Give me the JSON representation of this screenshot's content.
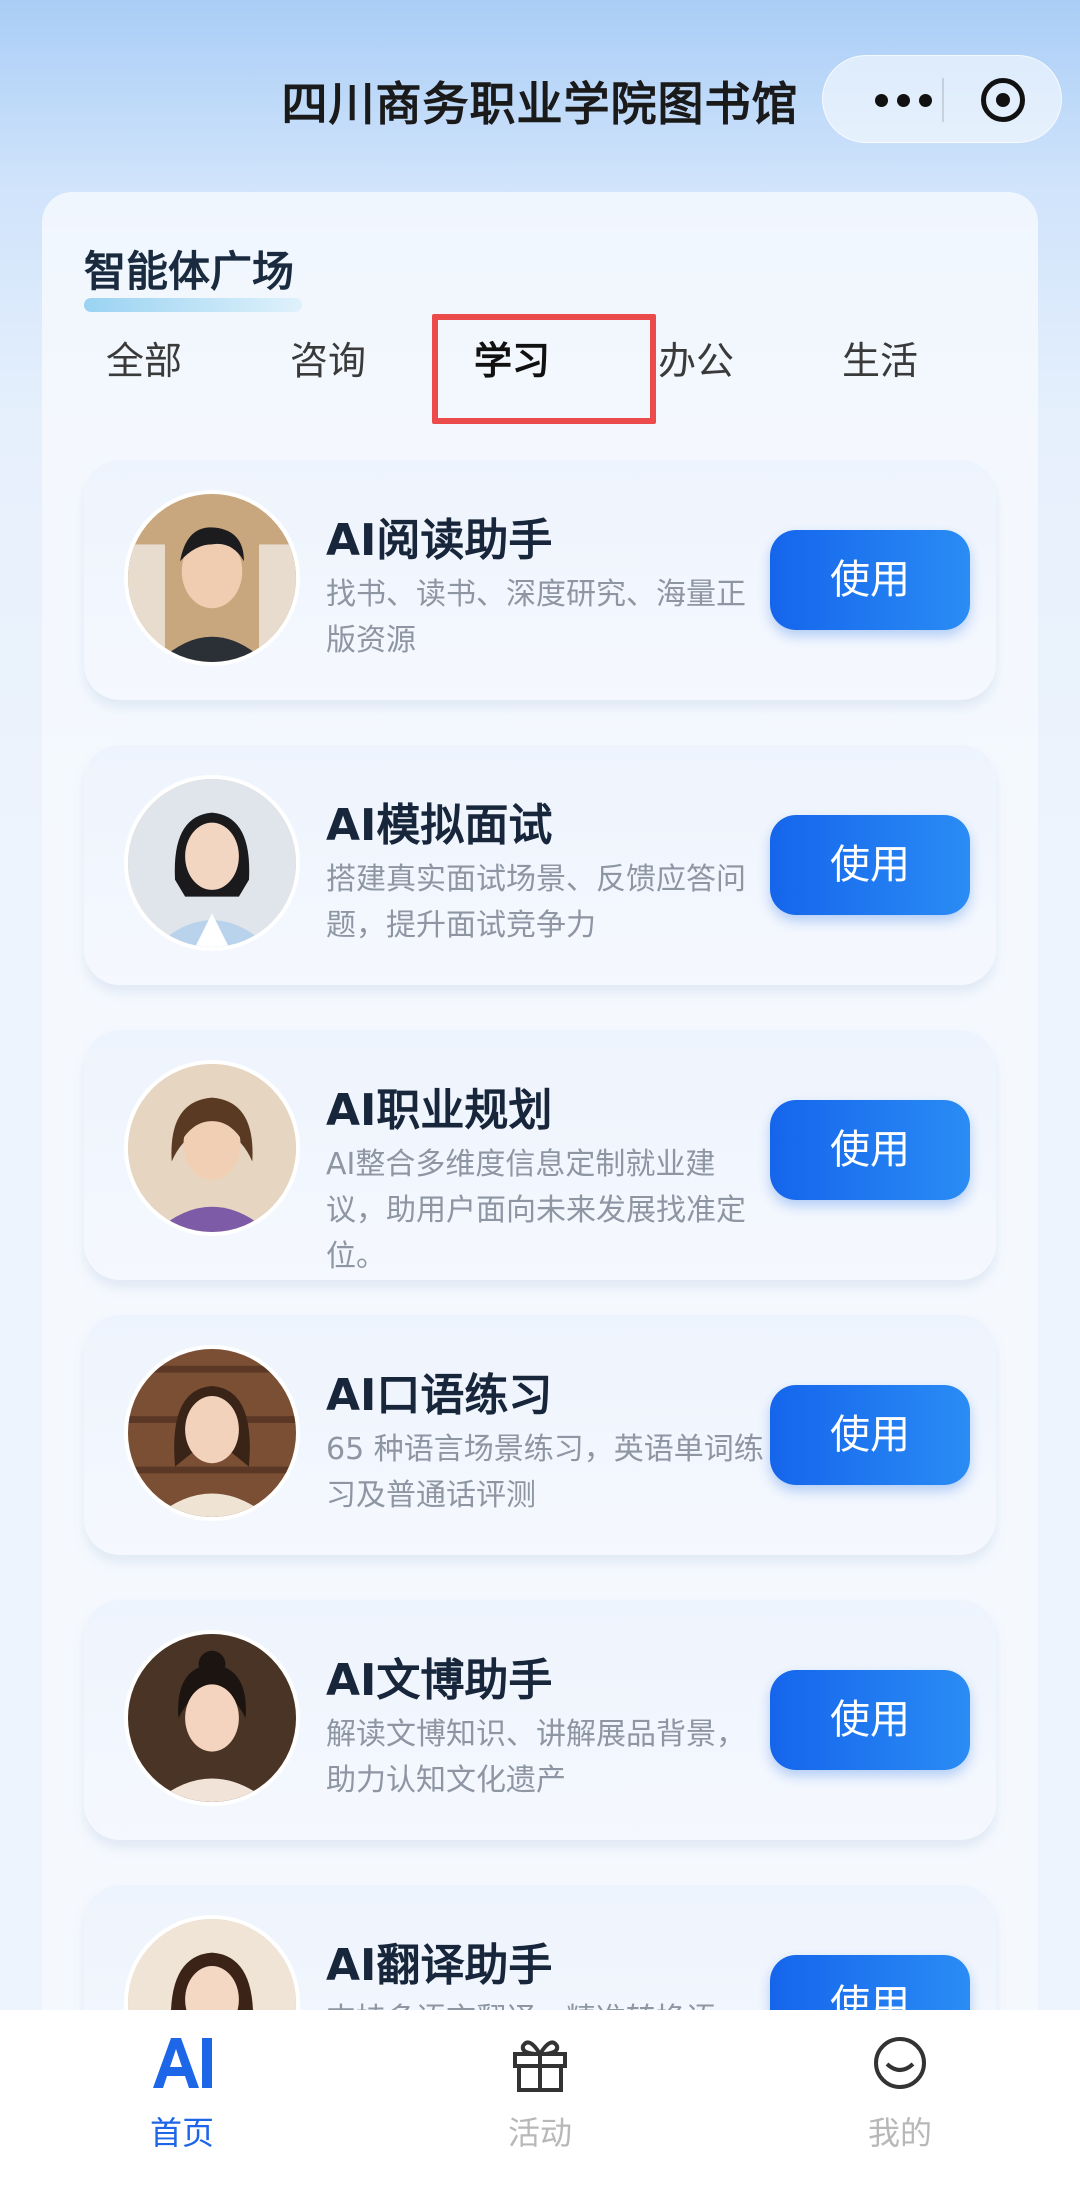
{
  "header": {
    "title": "四川商务职业学院图书馆",
    "more_icon": "more-dots-icon",
    "close_icon": "target-icon"
  },
  "section": {
    "title": "智能体广场"
  },
  "tabs": [
    {
      "label": "全部"
    },
    {
      "label": "咨询"
    },
    {
      "label": "学习",
      "active": true
    },
    {
      "label": "办公"
    },
    {
      "label": "生活"
    }
  ],
  "cards": [
    {
      "title": "AI阅读助手",
      "desc": "找书、读书、深度研究、海量正版资源",
      "button": "使用"
    },
    {
      "title": "AI模拟面试",
      "desc": "搭建真实面试场景、反馈应答问题，提升面试竞争力",
      "button": "使用"
    },
    {
      "title": "AI职业规划",
      "desc": "AI整合多维度信息定制就业建议，助用户面向未来发展找准定位。",
      "button": "使用"
    },
    {
      "title": "AI口语练习",
      "desc": "65 种语言场景练习，英语单词练习及普通话评测",
      "button": "使用"
    },
    {
      "title": "AI文博助手",
      "desc": "解读文博知识、讲解展品背景，助力认知文化遗产",
      "button": "使用"
    },
    {
      "title": "AI翻译助手",
      "desc": "支持多语言翻译，精准转换语",
      "button": "使用"
    }
  ],
  "nav": {
    "home": {
      "label": "首页",
      "icon": "ai-logo-icon"
    },
    "activity": {
      "label": "活动",
      "icon": "gift-icon"
    },
    "mine": {
      "label": "我的",
      "icon": "smile-icon"
    }
  },
  "colors": {
    "accent": "#1d66e8",
    "highlight": "#ec4b4b"
  }
}
